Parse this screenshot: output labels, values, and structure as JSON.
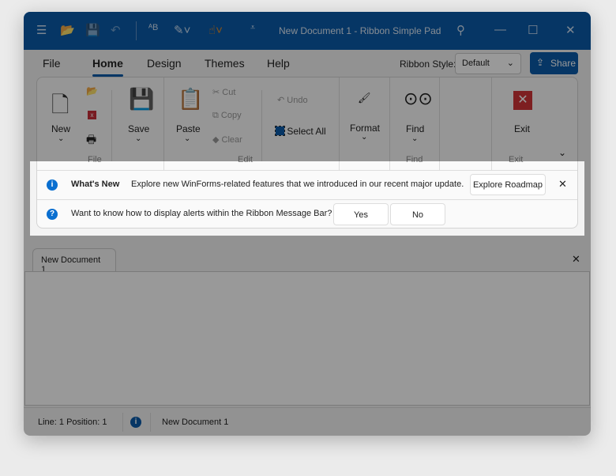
{
  "window": {
    "title": "New Document 1 - Ribbon Simple Pad"
  },
  "tabs": [
    "File",
    "Home",
    "Design",
    "Themes",
    "Help"
  ],
  "ribbon_style": {
    "label": "Ribbon Style:",
    "value": "Default"
  },
  "share_label": "Share",
  "groups": {
    "file": {
      "label": "File",
      "new": "New",
      "save": "Save"
    },
    "edit": {
      "label": "Edit",
      "paste": "Paste",
      "cut": "Cut",
      "copy": "Copy",
      "clear": "Clear",
      "undo": "Undo",
      "select_all": "Select All"
    },
    "format": {
      "format": "Format"
    },
    "find": {
      "label": "Find",
      "find": "Find"
    },
    "exit": {
      "label": "Exit",
      "exit": "Exit"
    }
  },
  "message_bar": {
    "row1": {
      "title": "What's New",
      "text": "Explore new WinForms-related features that we introduced in our recent major update.",
      "button": "Explore Roadmap"
    },
    "row2": {
      "text": "Want to know how to display alerts within the Ribbon Message Bar?",
      "yes": "Yes",
      "no": "No"
    }
  },
  "document_tab": "New Document 1",
  "status": {
    "position": "Line: 1  Position: 1",
    "document": "New Document 1"
  },
  "colors": {
    "accent": "#0a5aa8",
    "info": "#0a6fd0",
    "exit": "#d13438"
  }
}
